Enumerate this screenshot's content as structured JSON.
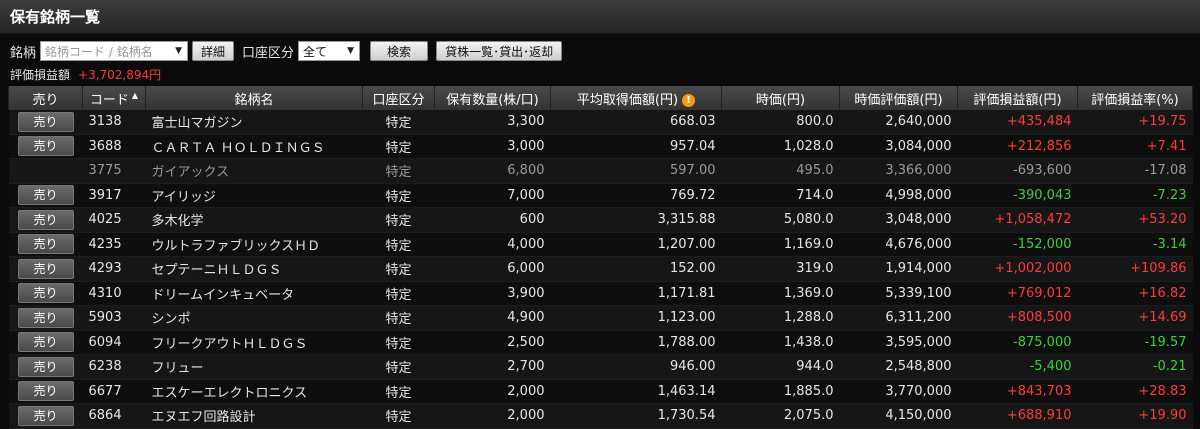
{
  "page": {
    "title": "保有銘柄一覧"
  },
  "search": {
    "symbol_label": "銘柄",
    "symbol_placeholder": "銘柄コード / 銘柄名",
    "detail_label": "詳細",
    "account_label": "口座区分",
    "account_value": "全て",
    "search_label": "検索",
    "lending_label": "貸株一覧･貸出･返却"
  },
  "summary": {
    "label": "評価損益額",
    "value": "+3,702,894円"
  },
  "columns": {
    "sell": "売り",
    "code": "コード",
    "name": "銘柄名",
    "account": "口座区分",
    "qty": "保有数量(株/口)",
    "avg": "平均取得価額(円)",
    "price": "時価(円)",
    "value": "時価評価額(円)",
    "pl": "評価損益額(円)",
    "plr": "評価損益率(%)"
  },
  "icons": {
    "sort": "sort-ascending-icon",
    "warning": "warning-icon"
  },
  "colors": {
    "positive": "#ff3b3b",
    "negative": "#3cd23c",
    "accent": "#f39c12"
  },
  "rows": [
    {
      "sell": "売り",
      "code": "3138",
      "name": "富士山マガジン",
      "account": "特定",
      "qty": "3,300",
      "avg": "668.03",
      "price": "800.0",
      "value": "2,640,000",
      "pl": "+435,484",
      "plr": "+19.75",
      "sign": "pos"
    },
    {
      "sell": "売り",
      "code": "3688",
      "name": "ＣＡＲＴＡ ＨＯＬＤＩＮＧＳ",
      "account": "特定",
      "qty": "3,000",
      "avg": "957.04",
      "price": "1,028.0",
      "value": "3,084,000",
      "pl": "+212,856",
      "plr": "+7.41",
      "sign": "pos"
    },
    {
      "sell": "",
      "code": "3775",
      "name": "ガイアックス",
      "account": "特定",
      "qty": "6,800",
      "avg": "597.00",
      "price": "495.0",
      "value": "3,366,000",
      "pl": "-693,600",
      "plr": "-17.08",
      "sign": "flat",
      "disabled": true
    },
    {
      "sell": "売り",
      "code": "3917",
      "name": "アイリッジ",
      "account": "特定",
      "qty": "7,000",
      "avg": "769.72",
      "price": "714.0",
      "value": "4,998,000",
      "pl": "-390,043",
      "plr": "-7.23",
      "sign": "neg"
    },
    {
      "sell": "売り",
      "code": "4025",
      "name": "多木化学",
      "account": "特定",
      "qty": "600",
      "avg": "3,315.88",
      "price": "5,080.0",
      "value": "3,048,000",
      "pl": "+1,058,472",
      "plr": "+53.20",
      "sign": "pos"
    },
    {
      "sell": "売り",
      "code": "4235",
      "name": "ウルトラファブリックスＨＤ",
      "account": "特定",
      "qty": "4,000",
      "avg": "1,207.00",
      "price": "1,169.0",
      "value": "4,676,000",
      "pl": "-152,000",
      "plr": "-3.14",
      "sign": "neg"
    },
    {
      "sell": "売り",
      "code": "4293",
      "name": "セプテーニＨＬＤＧＳ",
      "account": "特定",
      "qty": "6,000",
      "avg": "152.00",
      "price": "319.0",
      "value": "1,914,000",
      "pl": "+1,002,000",
      "plr": "+109.86",
      "sign": "pos"
    },
    {
      "sell": "売り",
      "code": "4310",
      "name": "ドリームインキュベータ",
      "account": "特定",
      "qty": "3,900",
      "avg": "1,171.81",
      "price": "1,369.0",
      "value": "5,339,100",
      "pl": "+769,012",
      "plr": "+16.82",
      "sign": "pos"
    },
    {
      "sell": "売り",
      "code": "5903",
      "name": "シンポ",
      "account": "特定",
      "qty": "4,900",
      "avg": "1,123.00",
      "price": "1,288.0",
      "value": "6,311,200",
      "pl": "+808,500",
      "plr": "+14.69",
      "sign": "pos"
    },
    {
      "sell": "売り",
      "code": "6094",
      "name": "フリークアウトＨＬＤＧＳ",
      "account": "特定",
      "qty": "2,500",
      "avg": "1,788.00",
      "price": "1,438.0",
      "value": "3,595,000",
      "pl": "-875,000",
      "plr": "-19.57",
      "sign": "neg"
    },
    {
      "sell": "売り",
      "code": "6238",
      "name": "フリュー",
      "account": "特定",
      "qty": "2,700",
      "avg": "946.00",
      "price": "944.0",
      "value": "2,548,800",
      "pl": "-5,400",
      "plr": "-0.21",
      "sign": "neg"
    },
    {
      "sell": "売り",
      "code": "6677",
      "name": "エスケーエレクトロニクス",
      "account": "特定",
      "qty": "2,000",
      "avg": "1,463.14",
      "price": "1,885.0",
      "value": "3,770,000",
      "pl": "+843,703",
      "plr": "+28.83",
      "sign": "pos"
    },
    {
      "sell": "売り",
      "code": "6864",
      "name": "エヌエフ回路設計",
      "account": "特定",
      "qty": "2,000",
      "avg": "1,730.54",
      "price": "2,075.0",
      "value": "4,150,000",
      "pl": "+688,910",
      "plr": "+19.90",
      "sign": "pos"
    }
  ]
}
